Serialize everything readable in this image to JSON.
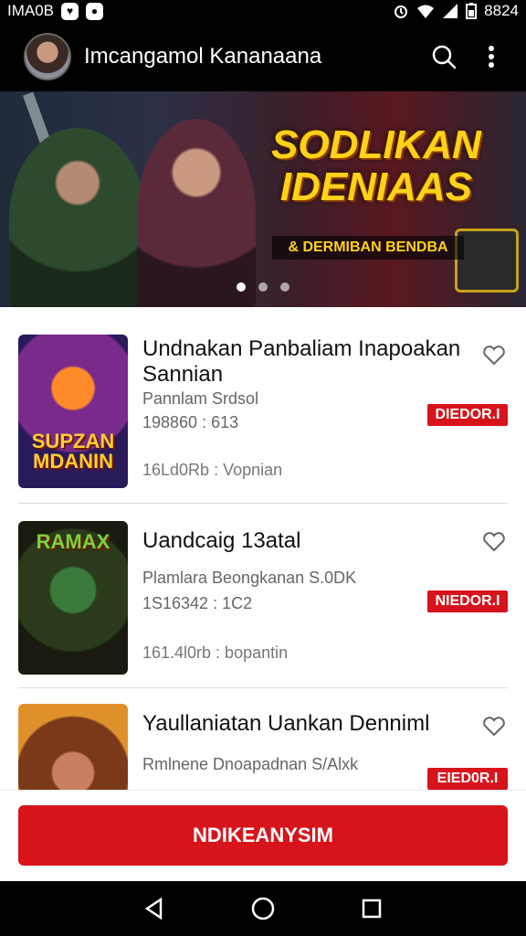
{
  "status": {
    "left_text": "IMA0B",
    "time": "8824"
  },
  "app_bar": {
    "title": "Imcangamol Kananaana"
  },
  "banner": {
    "title": "SODLIKAN IDENIAAS",
    "subtitle": "& DERMIBAN BENDBA",
    "dots": 3,
    "active_dot": 0
  },
  "items": [
    {
      "thumb_caption": "SUPZAN MDANIN",
      "title": "Undnakan Panbaliam Inapoakan Sannian",
      "subtitle": "Pannlam Srdsol",
      "meta": "198860 : 613",
      "info": "16Ld0Rb : Vopnian",
      "badge": "DIEDOR.I"
    },
    {
      "thumb_caption": "RAMAX",
      "title": "Uandcaig 13atal",
      "subtitle": "Plamlara Beongkanan S.0DK",
      "meta": "1S16342 : 1C2",
      "info": "161.4l0rb : bopantin",
      "badge": "NIEDOR.I"
    },
    {
      "thumb_caption": "",
      "title": "Yaullaniatan Uankan Denniml",
      "subtitle": "Rmlnene Dnoapadnan S/Alxk",
      "meta": "",
      "info": "",
      "badge": "EIED0R.I"
    }
  ],
  "cta": {
    "label": "NDIKEANYSIM"
  }
}
